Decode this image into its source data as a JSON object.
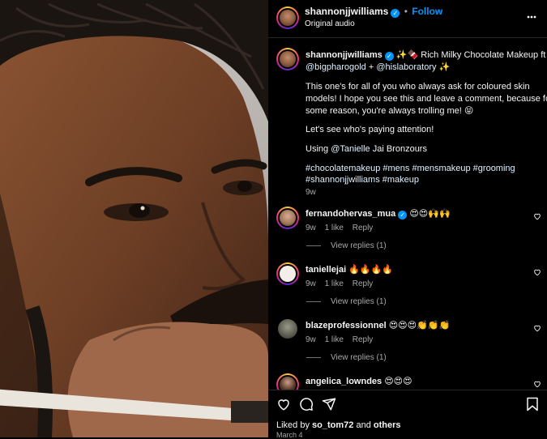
{
  "post": {
    "username": "shannonjjwilliams",
    "follow_label": "Follow",
    "audio": "Original audio",
    "more_icon": "more-horizontal-icon"
  },
  "caption": {
    "username": "shannonjjwilliams",
    "title_emoji_prefix": "✨🍫",
    "title_text": "Rich Milky Chocolate Makeup ft",
    "mention_1": "@bigpharogold",
    "plus": "+",
    "mention_2": "@hislaboratory",
    "title_emoji_suffix": "✨",
    "paragraph_1_line_1": "This one's for all of you who always ask for coloured skin",
    "paragraph_1_line_2": "models! I hope you see this and leave a comment, because for",
    "paragraph_1_line_3": "some reason, you're always trolling me! 😝",
    "paragraph_2": "Let's see who's paying attention!",
    "using_prefix": "Using",
    "using_mention": "@Tanielle",
    "using_suffix": "Jai Bronzours",
    "hashtags_line_1": "#chocolatemakeup #mens #mensmakeup #grooming",
    "hashtags_line_2": "#shannonjjwilliams #makeup",
    "age": "9w"
  },
  "comments": [
    {
      "username": "fernandohervas_mua",
      "verified": true,
      "text": "😍😍🙌🙌",
      "age": "9w",
      "likes": "1 like",
      "reply": "Reply",
      "view_replies": "View replies (1)"
    },
    {
      "username": "taniellejai",
      "verified": false,
      "text": "🔥🔥🔥🔥",
      "age": "9w",
      "likes": "1 like",
      "reply": "Reply",
      "view_replies": "View replies (1)"
    },
    {
      "username": "blazeprofessionnel",
      "verified": false,
      "text": "😍😍😍👏👏👏",
      "age": "9w",
      "likes": "1 like",
      "reply": "Reply",
      "view_replies": "View replies (1)"
    },
    {
      "username": "angelica_lowndes",
      "verified": false,
      "text": "😍😍😍"
    }
  ],
  "footer": {
    "liked_prefix": "Liked by",
    "liked_user": "so_tom72",
    "liked_and": "and",
    "liked_others": "others",
    "date": "March 4"
  },
  "icons": {
    "like": "heart-icon",
    "comment": "comment-icon",
    "share": "send-icon",
    "save": "bookmark-icon"
  },
  "colors": {
    "link": "#e0f1ff",
    "verified": "#0095f6",
    "muted": "#a8a8a8",
    "border": "#262626"
  }
}
